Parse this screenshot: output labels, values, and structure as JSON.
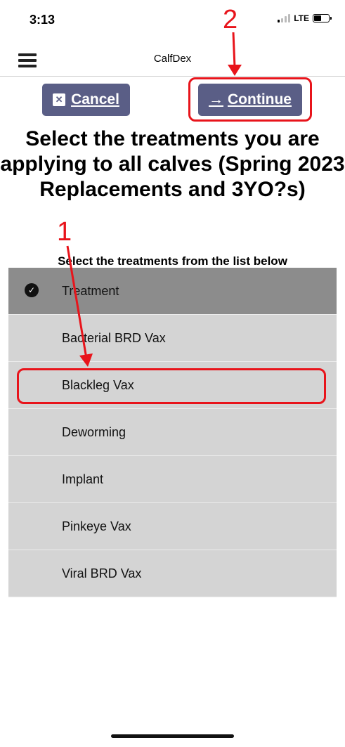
{
  "status_bar": {
    "time": "3:13",
    "network": "LTE"
  },
  "nav": {
    "title": "CalfDex",
    "menu_icon": "hamburger-menu-icon"
  },
  "buttons": {
    "cancel_label": "Cancel",
    "continue_label": "Continue"
  },
  "heading": "Select the treatments you are applying to all calves (Spring 2023 Replacements and 3YO?s)",
  "subheading": "Select the treatments from the list below",
  "list": {
    "header": "Treatment",
    "items": [
      "Bacterial BRD Vax",
      "Blackleg Vax",
      "Deworming",
      "Implant",
      "Pinkeye Vax",
      "Viral BRD Vax"
    ]
  },
  "annotations": {
    "step1": "1",
    "step2": "2",
    "color": "#e8141b"
  }
}
